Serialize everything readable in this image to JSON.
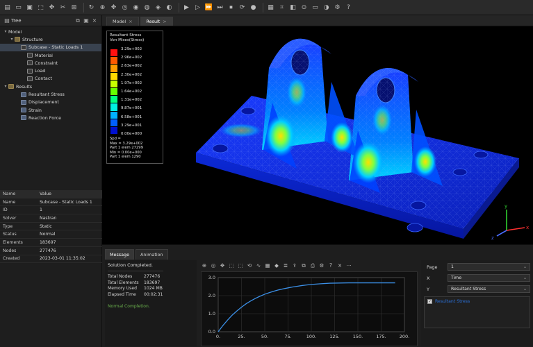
{
  "toolbar": {
    "groups": [
      [
        "file-new-icon",
        "folder-open-icon",
        "save-icon",
        "select-icon",
        "transform-icon",
        "tool-a-icon",
        "tool-b-icon"
      ],
      [
        "rotate-icon",
        "zoom-icon",
        "pan-icon",
        "fit-icon",
        "view-front-icon",
        "view-top-icon",
        "view-iso-icon",
        "view-side-icon"
      ],
      [
        "play-icon",
        "step-forward-icon",
        "fast-forward-icon",
        "next-frame-icon",
        "end-icon",
        "loop-icon",
        "record-icon"
      ],
      [
        "grid-icon",
        "measure-icon",
        "section-icon",
        "probe-icon",
        "display-icon",
        "color-icon",
        "settings-icon",
        "help-icon"
      ]
    ]
  },
  "left_panel": {
    "title": "Tree",
    "tree": [
      {
        "label": "Model",
        "level": 0,
        "toggle": "▾",
        "icon": "none"
      },
      {
        "label": "Structure",
        "level": 1,
        "toggle": "▾",
        "icon": "folder"
      },
      {
        "label": "Subcase - Static Loads 1",
        "level": 2,
        "toggle": "",
        "icon": "item",
        "selected": true
      },
      {
        "label": "Material",
        "level": 3,
        "toggle": "",
        "icon": "item"
      },
      {
        "label": "Constraint",
        "level": 3,
        "toggle": "",
        "icon": "item"
      },
      {
        "label": "Load",
        "level": 3,
        "toggle": "",
        "icon": "item"
      },
      {
        "label": "Contact",
        "level": 3,
        "toggle": "",
        "icon": "item"
      },
      {
        "label": "Results",
        "level": 0,
        "toggle": "▾",
        "icon": "folder"
      },
      {
        "label": "Resultant Stress",
        "level": 2,
        "toggle": "",
        "icon": "res"
      },
      {
        "label": "Displacement",
        "level": 2,
        "toggle": "",
        "icon": "res"
      },
      {
        "label": "Strain",
        "level": 2,
        "toggle": "",
        "icon": "res"
      },
      {
        "label": "Reaction Force",
        "level": 2,
        "toggle": "",
        "icon": "res"
      }
    ],
    "properties": {
      "header": {
        "name": "Name",
        "value": "Value"
      },
      "rows": [
        {
          "key": "Name",
          "value": "Subcase - Static Loads 1"
        },
        {
          "key": "ID",
          "value": "1"
        },
        {
          "key": "Solver",
          "value": "Nastran"
        },
        {
          "key": "Type",
          "value": "Static"
        },
        {
          "key": "Status",
          "value": "Normal"
        },
        {
          "key": "Elements",
          "value": "183697"
        },
        {
          "key": "Nodes",
          "value": "277476"
        },
        {
          "key": "Created",
          "value": "2023-03-01 11:35:02"
        }
      ]
    }
  },
  "tabs": [
    {
      "label": "Model",
      "close": "×",
      "active": false
    },
    {
      "label": "Result",
      "close": ">",
      "active": true
    }
  ],
  "legend": {
    "title_line1": "Resultant Stress",
    "title_line2": "Von Mises(Stress)",
    "values": [
      "3.29e+002",
      "2.96e+002",
      "2.63e+002",
      "2.30e+002",
      "1.97e+002",
      "1.64e+002",
      "1.31e+002",
      "9.87e+001",
      "6.58e+001",
      "3.29e+001",
      "0.00e+000"
    ],
    "colors": [
      "#ff1010",
      "#ff5a00",
      "#ff9c00",
      "#ffd800",
      "#c8ff00",
      "#66ff00",
      "#00ff80",
      "#00f0e0",
      "#00b0ff",
      "#0060ff",
      "#0010d0"
    ],
    "foot": [
      "Spd =",
      "Max = 3.29e+002",
      "Part 1 elem 27299",
      "Min = 0.00e+000",
      "Part 1 elem 1290"
    ]
  },
  "axes_triad": {
    "x": "x",
    "y": "y",
    "z": "z"
  },
  "bottom": {
    "tabs": [
      {
        "label": "Message",
        "active": true
      },
      {
        "label": "Animation",
        "active": false
      }
    ],
    "message": {
      "title": "Solution Completed.",
      "rows": [
        {
          "key": "Total Nodes",
          "value": "277476"
        },
        {
          "key": "Total Elements",
          "value": "183697"
        },
        {
          "key": "Memory Used",
          "value": "1024 MB"
        },
        {
          "key": "Elapsed Time",
          "value": "00:02:31"
        }
      ],
      "status": "Normal Completion."
    },
    "graph_toolbar": [
      "zoom-icon",
      "fit-icon",
      "pan-icon",
      "select-icon",
      "box-zoom-icon",
      "reset-icon",
      "curve-icon",
      "grid-icon",
      "marker-icon",
      "legend-icon",
      "export-icon",
      "copy-icon",
      "print-icon",
      "settings-icon",
      "help-icon",
      "close-icon",
      "more-icon"
    ]
  },
  "chart_data": {
    "type": "line",
    "x": [
      0,
      5,
      10,
      15,
      20,
      25,
      30,
      35,
      40,
      45,
      50,
      55,
      60,
      65,
      70,
      75,
      80,
      85,
      90,
      95,
      100,
      110,
      120,
      130,
      140,
      150,
      160,
      170,
      180,
      190
    ],
    "series": [
      {
        "values": [
          0.0,
          0.34,
          0.64,
          0.92,
          1.15,
          1.36,
          1.55,
          1.71,
          1.85,
          1.97,
          2.08,
          2.17,
          2.25,
          2.32,
          2.38,
          2.43,
          2.48,
          2.52,
          2.56,
          2.59,
          2.62,
          2.66,
          2.69,
          2.7,
          2.71,
          2.71,
          2.71,
          2.71,
          2.71,
          2.71
        ]
      }
    ],
    "x_ticks": [
      "0.",
      "25.",
      "50.",
      "75.",
      "100.",
      "125.",
      "150.",
      "175.",
      "200."
    ],
    "x_tick_values": [
      0,
      25,
      50,
      75,
      100,
      125,
      150,
      175,
      200
    ],
    "y_ticks": [
      "0.0",
      "1.0",
      "2.0",
      "3.0"
    ],
    "y_tick_values": [
      0,
      1,
      2,
      3
    ],
    "xlim": [
      0,
      200
    ],
    "ylim": [
      0,
      3
    ],
    "grid": true,
    "line_color": "#3b8fe6"
  },
  "plot_settings": {
    "page": {
      "label": "Page",
      "value": "1"
    },
    "x": {
      "label": "X",
      "value": "Time"
    },
    "y": {
      "label": "Y",
      "value": "Resultant Stress"
    },
    "curve": {
      "label": "Resultant Stress",
      "checked": true
    }
  }
}
